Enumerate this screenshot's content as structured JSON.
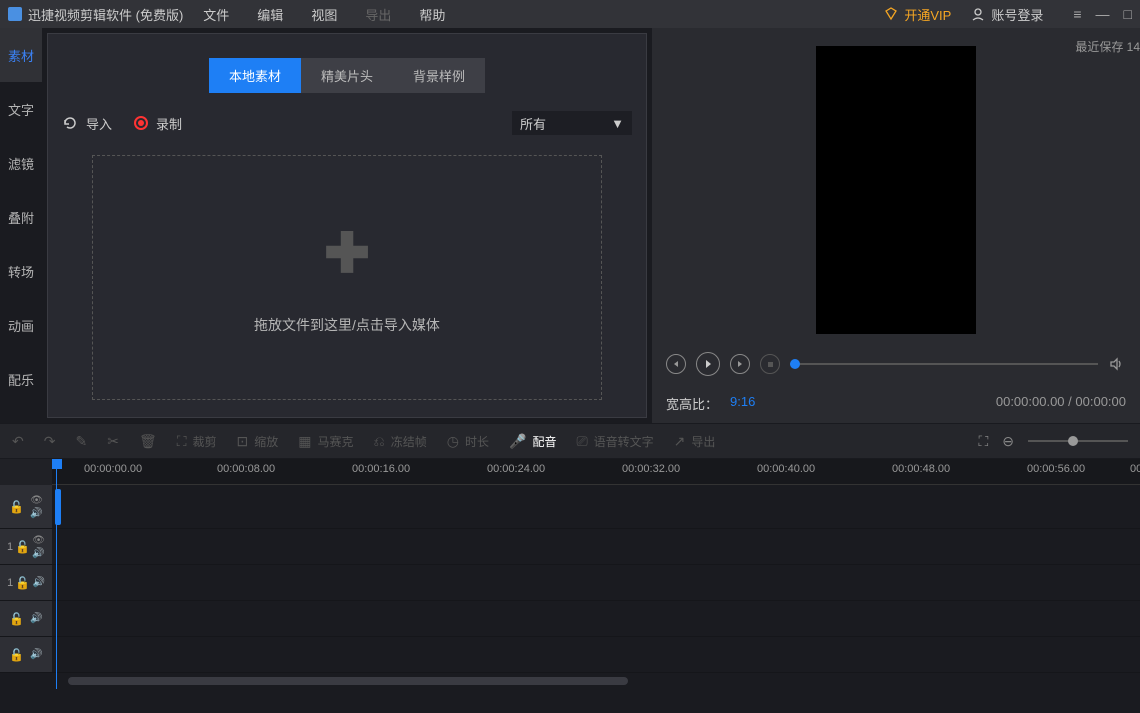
{
  "app": {
    "title": "迅捷视频剪辑软件 (免费版)"
  },
  "menu": {
    "file": "文件",
    "edit": "编辑",
    "view": "视图",
    "export": "导出",
    "help": "帮助"
  },
  "menubar_right": {
    "vip": "开通VIP",
    "login": "账号登录"
  },
  "sidebar": {
    "material": "素材",
    "text": "文字",
    "filter": "滤镜",
    "overlay": "叠附",
    "transition": "转场",
    "animation": "动画",
    "music": "配乐"
  },
  "media_panel": {
    "tab_local": "本地素材",
    "tab_opening": "精美片头",
    "tab_background": "背景样例",
    "import": "导入",
    "record": "录制",
    "filter_select": "所有",
    "dropzone_text": "拖放文件到这里/点击导入媒体"
  },
  "preview": {
    "save_label": "最近保存 14",
    "aspect_label": "宽高比：",
    "aspect_value": "9:16",
    "time_current": "00:00:00.00",
    "time_total": "00:00:00"
  },
  "toolbar": {
    "crop": "裁剪",
    "zoom": "缩放",
    "mosaic": "马赛克",
    "freeze": "冻结帧",
    "duration": "时长",
    "voice": "配音",
    "speech2text": "语音转文字",
    "export": "导出"
  },
  "timeline": {
    "ticks": [
      "00:00:00.00",
      "00:00:08.00",
      "00:00:16.00",
      "00:00:24.00",
      "00:00:32.00",
      "00:00:40.00",
      "00:00:48.00",
      "00:00:56.00",
      "00"
    ],
    "track_num_1": "1",
    "track_num_2": "1"
  }
}
